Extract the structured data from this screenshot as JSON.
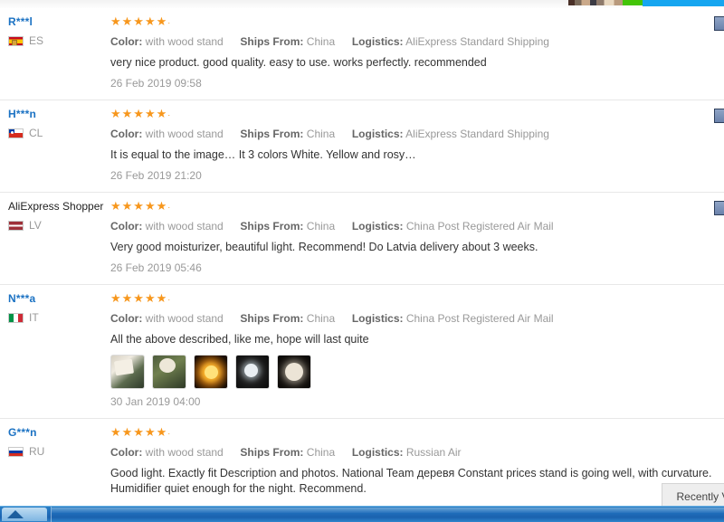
{
  "top_strip": {
    "accent_blue": "#16a6f0",
    "accent_green": "#43c407"
  },
  "labels": {
    "color": "Color:",
    "ships_from": "Ships From:",
    "logistics": "Logistics:",
    "stars_glyphs": "★★★★★",
    "stars_trailing_dot": "·"
  },
  "reviews": [
    {
      "name": "R***l",
      "name_is_link": true,
      "country_code": "ES",
      "flag": "flag-es",
      "stars": 5,
      "color_value": "with wood stand",
      "ships_from_value": "China",
      "logistics_value": "AliExpress Standard Shipping",
      "text": "very nice product. good quality. easy to use. works perfectly. recommended",
      "date": "26 Feb 2019 09:58",
      "thumbnails": []
    },
    {
      "name": "H***n",
      "name_is_link": true,
      "country_code": "CL",
      "flag": "flag-cl",
      "stars": 5,
      "color_value": "with wood stand",
      "ships_from_value": "China",
      "logistics_value": "AliExpress Standard Shipping",
      "text": "It is equal to the image… It 3 colors White. Yellow and rosy…",
      "date": "26 Feb 2019 21:20",
      "thumbnails": []
    },
    {
      "name": "AliExpress Shopper",
      "name_is_link": false,
      "country_code": "LV",
      "flag": "flag-lv",
      "stars": 5,
      "color_value": "with wood stand",
      "ships_from_value": "China",
      "logistics_value": "China Post Registered Air Mail",
      "text": "Very good moisturizer, beautiful light. Recommend! Do Latvia delivery about 3 weeks.",
      "date": "26 Feb 2019 05:46",
      "thumbnails": []
    },
    {
      "name": "N***a",
      "name_is_link": true,
      "country_code": "IT",
      "flag": "flag-it",
      "stars": 5,
      "color_value": "with wood stand",
      "ships_from_value": "China",
      "logistics_value": "China Post Registered Air Mail",
      "text": "All the above described, like me, hope will last quite",
      "date": "30 Jan 2019 04:00",
      "thumbnails": [
        "thumb-a",
        "thumb-b",
        "thumb-c",
        "thumb-d",
        "thumb-e"
      ]
    },
    {
      "name": "G***n",
      "name_is_link": true,
      "country_code": "RU",
      "flag": "flag-ru",
      "stars": 5,
      "color_value": "with wood stand",
      "ships_from_value": "China",
      "logistics_value": "Russian Air",
      "text": "Good light. Exactly fit Description and photos. National Team деревя Constant prices stand is going well, with curvature. Humidifier quiet enough for the night. Recommend.",
      "date": "",
      "thumbnails": []
    }
  ],
  "recently_viewed": {
    "label": "Recently V"
  },
  "taskbar": {
    "start_label": ""
  }
}
